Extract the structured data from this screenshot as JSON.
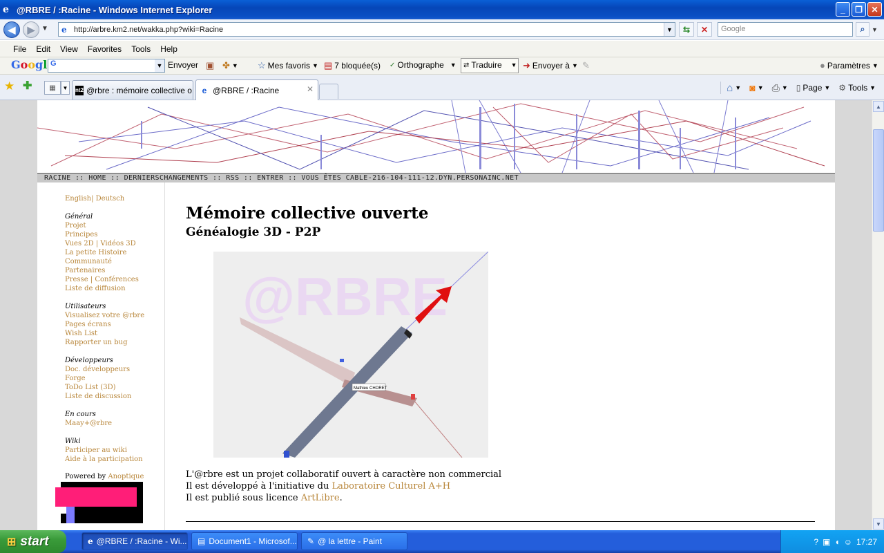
{
  "window": {
    "title": "@RBRE / :Racine - Windows Internet Explorer",
    "controls": [
      "_",
      "❐",
      "✕"
    ]
  },
  "address": {
    "url": "http://arbre.km2.net/wakka.php?wiki=Racine",
    "search_placeholder": "Google"
  },
  "menu": [
    "File",
    "Edit",
    "View",
    "Favorites",
    "Tools",
    "Help"
  ],
  "google_toolbar": {
    "logo": "Google",
    "select_value": "G",
    "send": "Envoyer",
    "favorites": "Mes favoris",
    "blocked": "7 bloquée(s)",
    "spell": "Orthographe",
    "translate": "Traduire",
    "send_to": "Envoyer à",
    "settings": "Paramètres"
  },
  "tabs": [
    {
      "label": "@rbre : mémoire collective o...",
      "favicon": "nt2"
    },
    {
      "label": "@RBRE / :Racine",
      "favicon": "ie"
    }
  ],
  "command_bar": {
    "page": "Page",
    "tools": "Tools"
  },
  "site": {
    "nav_line": "RACINE :: HOME :: DERNIERSCHANGEMENTS :: RSS :: ENTRER :: VOUS ÊTES CABLE-216-104-111-12.DYN.PERSONAINC.NET",
    "languages": "English| Deutsch",
    "sidebar": [
      {
        "title": "Général",
        "links": [
          "Projet",
          "Principes",
          "Vues 2D | Vidéos 3D",
          "La petite Histoire",
          "Communauté",
          "Partenaires",
          "Presse | Conférences",
          "Liste de diffusion"
        ]
      },
      {
        "title": "Utilisateurs",
        "links": [
          "Visualisez votre @rbre",
          "Pages écrans",
          "Wish List",
          "Rapporter un bug"
        ]
      },
      {
        "title": "Développeurs",
        "links": [
          "Doc. développeurs",
          "Forge",
          "ToDo List (3D)",
          "Liste de discussion"
        ]
      },
      {
        "title": "En cours",
        "links": [
          "Maay+@rbre"
        ]
      },
      {
        "title": "Wiki",
        "links": [
          "Participer au wiki",
          "Aide à la participation"
        ]
      }
    ],
    "powered_by": "Powered by",
    "powered_link": "Anoptique",
    "heading": "Mémoire collective ouverte",
    "subheading": "Généalogie 3D - P2P",
    "scene_watermark": "@RBRE",
    "scene_label": "Mathieu CHORET",
    "intro": {
      "line1": "L'@rbre est un projet collaboratif ouvert à caractère non commercial",
      "line2_prefix": "Il est développé à l'initiative du ",
      "line2_link": "Laboratoire Culturel A+H",
      "line3_prefix": "Il est publié sous licence ",
      "line3_link": "ArtLibre",
      "line3_suffix": "."
    }
  },
  "taskbar": {
    "start": "start",
    "tasks": [
      "@RBRE / :Racine - Wi...",
      "Document1 - Microsof...",
      "@ la lettre - Paint"
    ],
    "clock": "17:27"
  },
  "colors": {
    "link": "#b8863a",
    "logo_pink": "#ff1e78",
    "xp_blue": "#245edb",
    "start_green": "#3a9b3a"
  }
}
